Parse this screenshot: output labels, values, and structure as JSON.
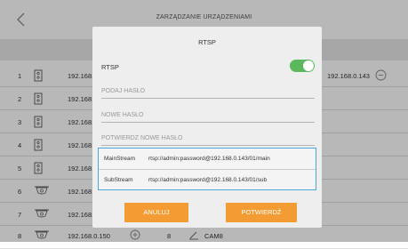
{
  "header": {
    "title": "ZARZĄDZANIE URZĄDZENIAMI"
  },
  "rows": [
    {
      "num": "1",
      "ip": "192.168.",
      "type": "nvr"
    },
    {
      "num": "2",
      "ip": "192.168.",
      "type": "nvr"
    },
    {
      "num": "3",
      "ip": "192.168.",
      "type": "nvr"
    },
    {
      "num": "4",
      "ip": "192.168.",
      "type": "nvr"
    },
    {
      "num": "5",
      "ip": "192.168.",
      "type": "nvr"
    },
    {
      "num": "6",
      "ip": "192.168.",
      "type": "cam"
    },
    {
      "num": "7",
      "ip": "192.168.",
      "type": "cam"
    },
    {
      "num": "8",
      "ip": "192.168.0.150",
      "type": "cam",
      "channel": "8",
      "cam_name": "CAM8"
    }
  ],
  "row1_right_ip": "192.168.0.143",
  "dialog": {
    "title": "RTSP",
    "rtsp_label": "RTSP",
    "rtsp_enabled": true,
    "current_password_placeholder": "PODAJ HASŁO",
    "new_password_placeholder": "NOWE HASŁO",
    "confirm_password_placeholder": "POTWIERDŹ NOWE HASŁO",
    "main_stream_label": "MainStream",
    "main_stream_url": "rtsp://admin:password@192.168.0.143/01/main",
    "sub_stream_label": "SubStream",
    "sub_stream_url": "rtsp://admin:password@192.168.0.143/01/sub",
    "cancel_label": "ANULUJ",
    "confirm_label": "POTWIERDŹ"
  },
  "colors": {
    "accent": "#f39c34",
    "toggle_on": "#5cb85c",
    "stream_border": "#4aa8d8"
  }
}
